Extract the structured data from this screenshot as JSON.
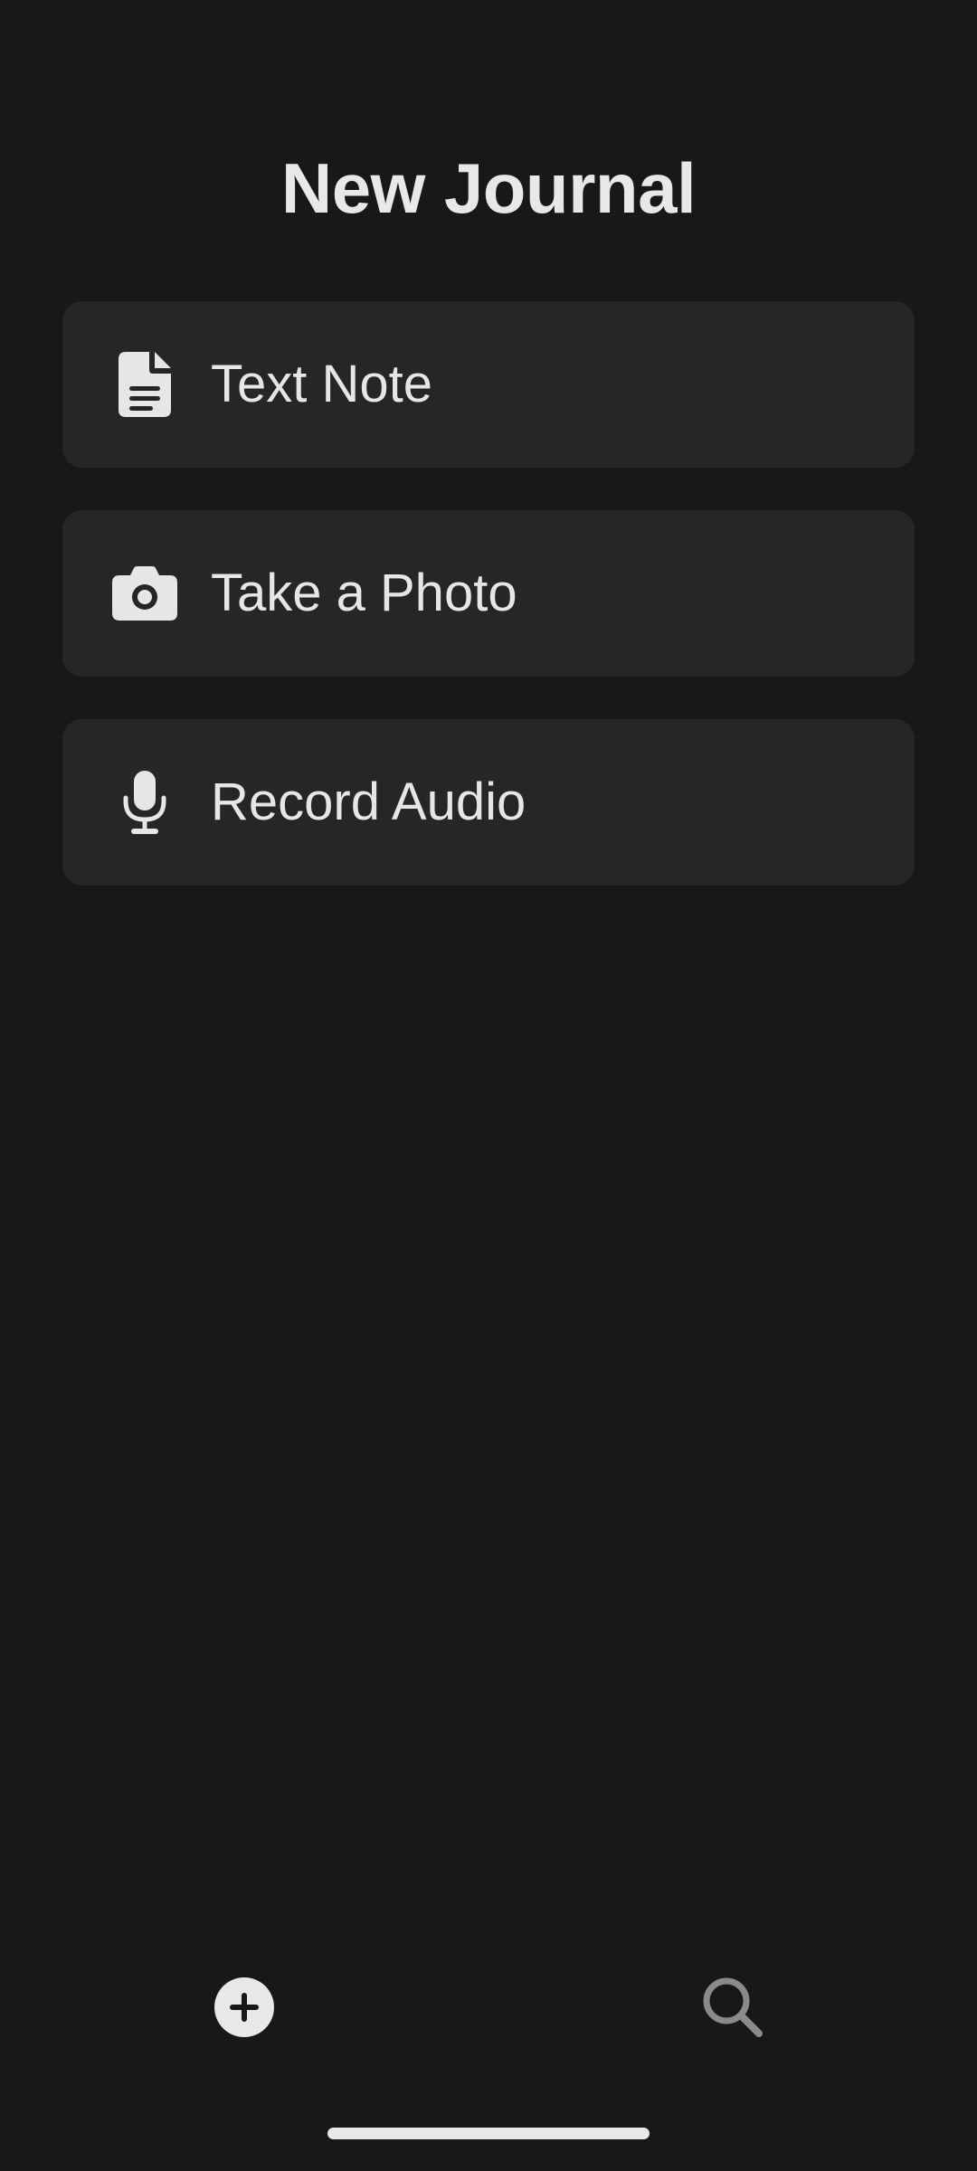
{
  "header": {
    "title": "New Journal"
  },
  "options": [
    {
      "icon": "document-icon",
      "label": "Text Note"
    },
    {
      "icon": "camera-icon",
      "label": "Take a Photo"
    },
    {
      "icon": "microphone-icon",
      "label": "Record Audio"
    }
  ],
  "bottom_nav": {
    "items": [
      {
        "icon": "add-circle-icon",
        "active": true
      },
      {
        "icon": "search-icon",
        "active": false
      }
    ]
  },
  "colors": {
    "background": "#181818",
    "card": "#262626",
    "text": "#e6e6e6",
    "inactive_icon": "#8a8a8a"
  }
}
